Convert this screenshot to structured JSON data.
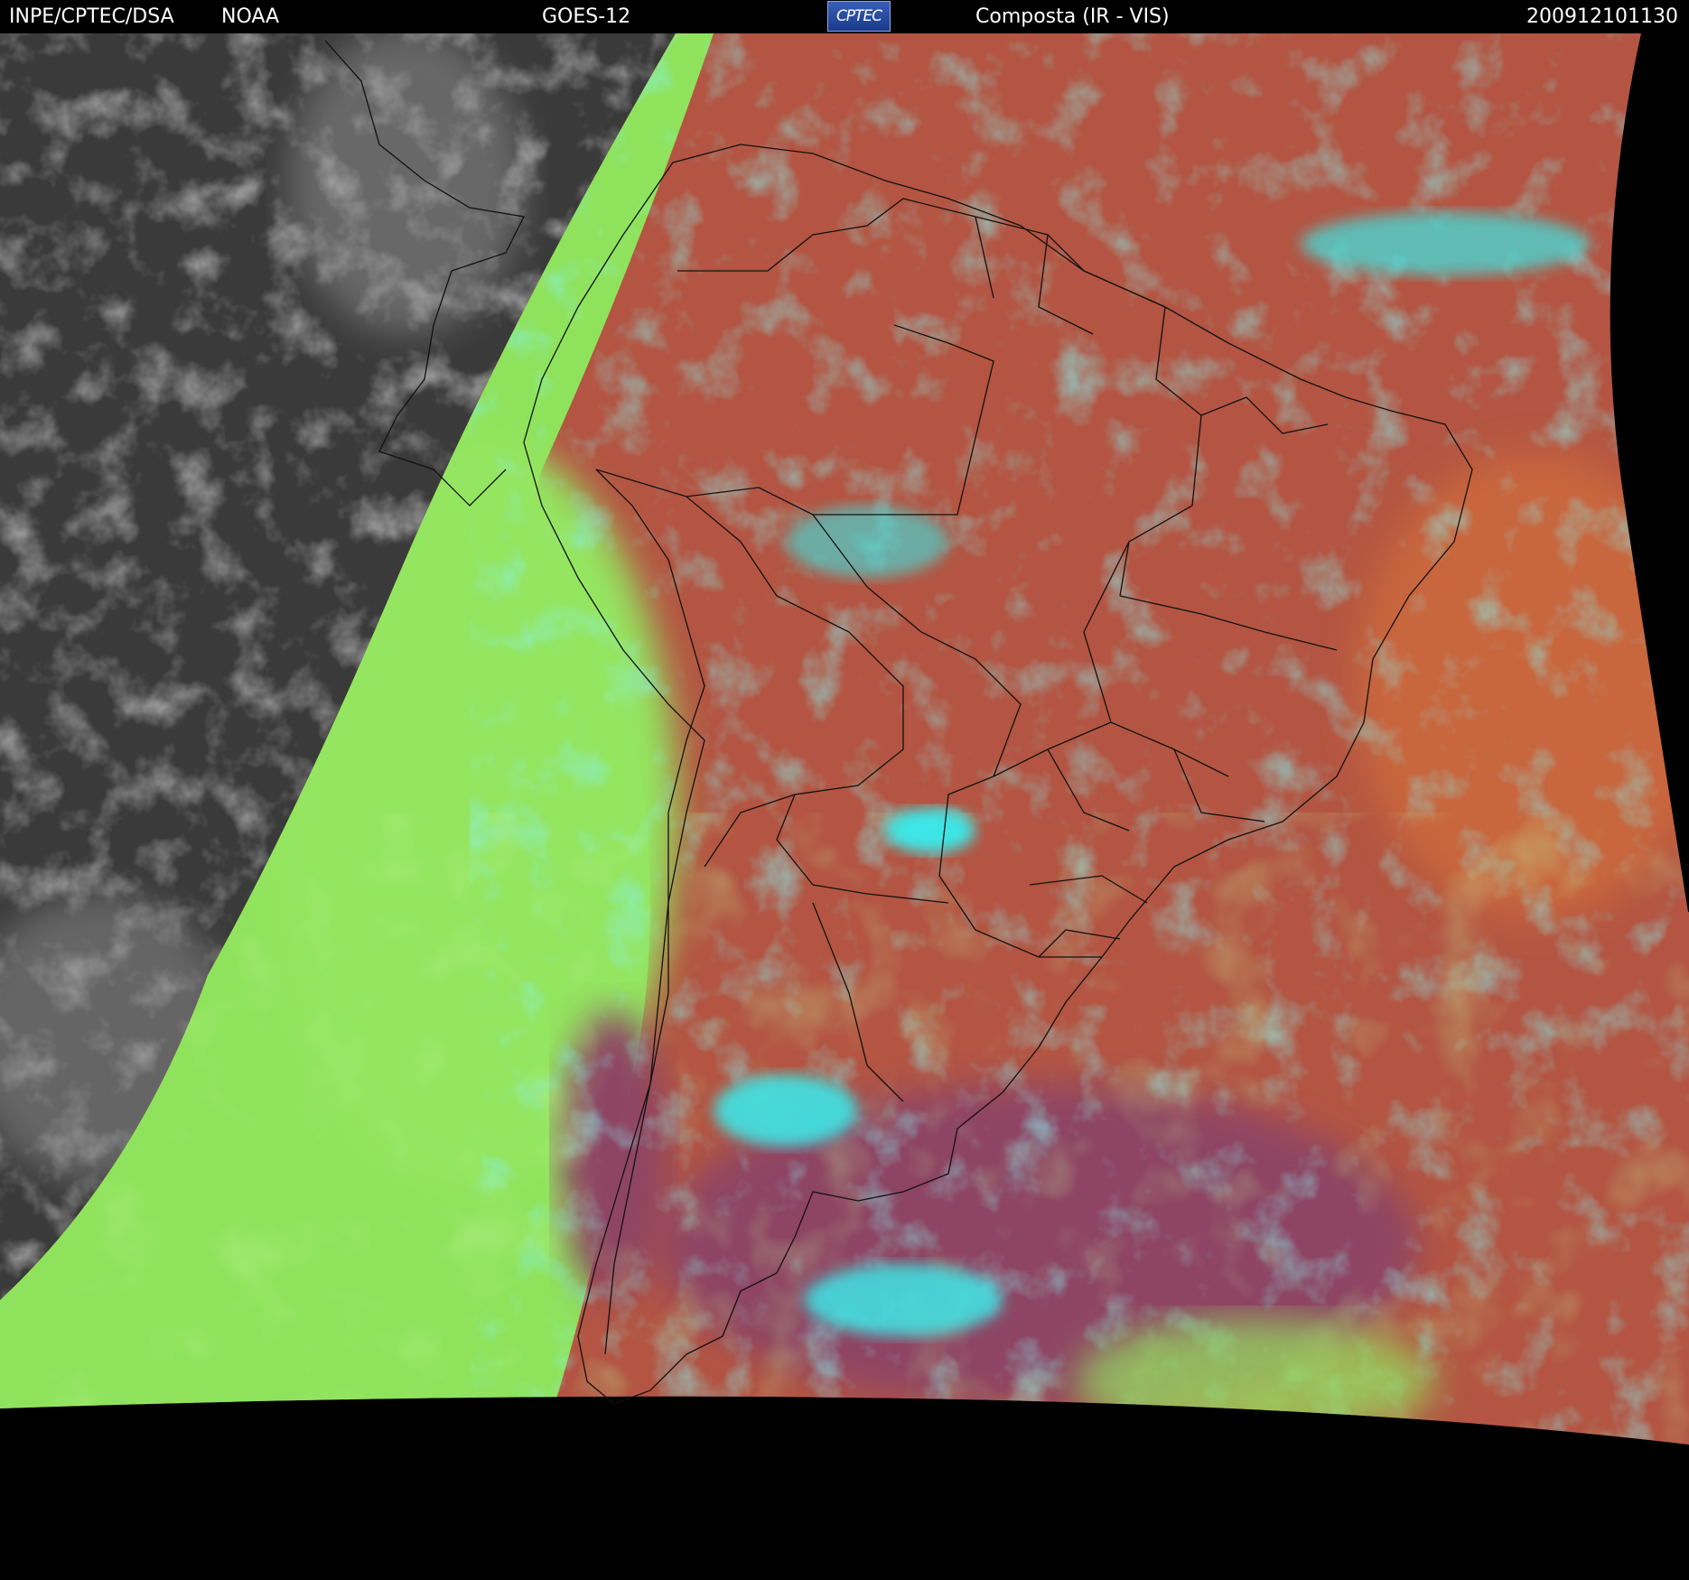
{
  "header": {
    "agency": "INPE/CPTEC/DSA",
    "partner": "NOAA",
    "satellite": "GOES-12",
    "logo_text": "CPTEC",
    "product": "Composta (IR - VIS)",
    "timestamp": "200912101130"
  },
  "colors": {
    "background": "#000000",
    "header_text": "#ffffff",
    "ir_night_gray": "#3a3a3a",
    "clear_ocean_green": "#8fe35c",
    "land_warm_red": "#b35542",
    "high_cloud_cyan": "#3ee6e6",
    "deep_south_magenta": "#8e4563",
    "border_lines": "#111111"
  },
  "icons": {
    "logo": "cptec-logo-icon"
  }
}
